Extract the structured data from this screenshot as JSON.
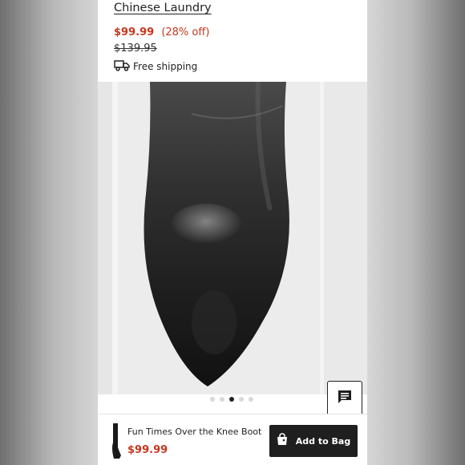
{
  "product": {
    "brand": "Chinese Laundry",
    "sale_price": "$99.99",
    "discount": "(28% off)",
    "original_price": "$139.95",
    "shipping": "Free shipping"
  },
  "gallery": {
    "image_icon": "boot-toe-photo",
    "slide_count": 5,
    "active_slide": 3
  },
  "chat": {
    "icon": "chat-icon"
  },
  "bottom_bar": {
    "name": "Fun Times Over the Knee Boot",
    "price": "$99.99",
    "add_to_bag": "Add to Bag",
    "bag_icon": "shopping-bag-icon"
  },
  "colors": {
    "sale": "#c7361f",
    "button": "#1f1f1f"
  }
}
